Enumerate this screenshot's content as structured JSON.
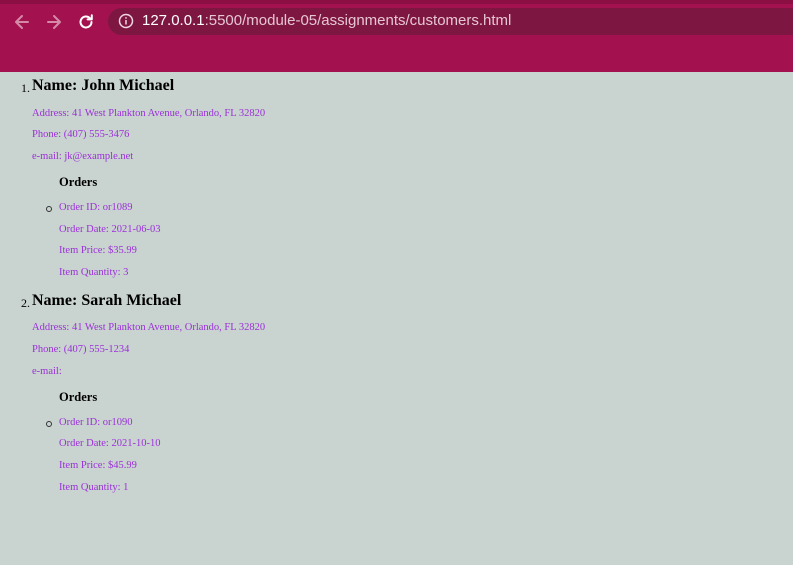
{
  "browser": {
    "url_host": "127.0.0.1",
    "url_path": ":5500/module-05/assignments/customers.html"
  },
  "customers": [
    {
      "number": "1.",
      "name": "Name: John Michael",
      "address": "Address: 41 West Plankton Avenue, Orlando, FL 32820",
      "phone": "Phone: (407) 555-3476",
      "email": "e-mail: jk@example.net",
      "orders_heading": "Orders",
      "order": {
        "id": "Order ID: or1089",
        "date": "Order Date: 2021-06-03",
        "price": "Item Price: $35.99",
        "quantity": "Item Quantity: 3"
      }
    },
    {
      "number": "2.",
      "name": "Name: Sarah Michael",
      "address": "Address: 41 West Plankton Avenue, Orlando, FL 32820",
      "phone": "Phone: (407) 555-1234",
      "email": "e-mail:",
      "orders_heading": "Orders",
      "order": {
        "id": "Order ID: or1090",
        "date": "Order Date: 2021-10-10",
        "price": "Item Price: $45.99",
        "quantity": "Item Quantity: 1"
      }
    }
  ]
}
